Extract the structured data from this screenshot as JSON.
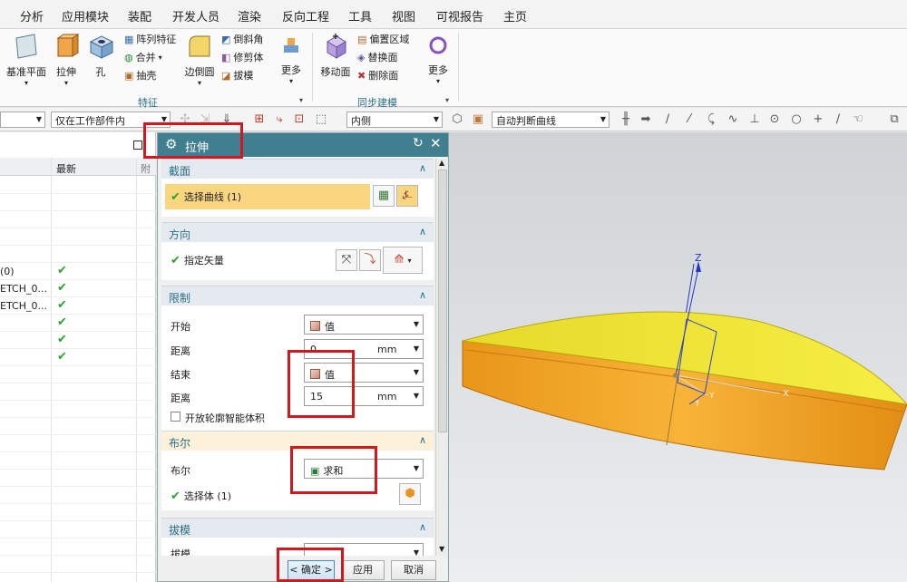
{
  "menu": [
    "分析",
    "应用模块",
    "装配",
    "开发人员",
    "渲染",
    "反向工程",
    "工具",
    "视图",
    "可视报告",
    "主页"
  ],
  "ribbon": {
    "datum_plane": "基准平面",
    "extrude": "拉伸",
    "hole": "孔",
    "pattern_feature": "阵列特征",
    "unite": "合并",
    "shell": "抽壳",
    "edge_blend": "边倒圆",
    "chamfer": "倒斜角",
    "trim_body": "修剪体",
    "draft": "拔模",
    "more1": "更多",
    "group_feature": "特征",
    "move_face": "移动面",
    "offset_region": "偏置区域",
    "replace_face": "替换面",
    "delete_face": "删除面",
    "more2": "更多",
    "group_sync": "同步建模"
  },
  "toolbar": {
    "filter_scope": "仅在工作部件内",
    "side": "内侧",
    "curve_rule": "自动判断曲线"
  },
  "navigator": {
    "col_latest": "最新",
    "rows": [
      {
        "name": "(0)",
        "check": "✔"
      },
      {
        "name": "ETCH_0...",
        "check": "✔"
      },
      {
        "name": "ETCH_0...",
        "check": "✔"
      },
      {
        "name": "",
        "check": "✔"
      },
      {
        "name": "",
        "check": "✔"
      },
      {
        "name": "",
        "check": "✔"
      }
    ]
  },
  "dialog": {
    "title": "拉伸",
    "section": {
      "title": "截面",
      "select_curve": "选择曲线 (1)"
    },
    "direction": {
      "title": "方向",
      "specify_vector": "指定矢量"
    },
    "limits": {
      "title": "限制",
      "start_label": "开始",
      "start_value": "值",
      "distance1_label": "距离",
      "distance1_value": "0",
      "distance1_unit": "mm",
      "end_label": "结束",
      "end_value": "值",
      "distance2_label": "距离",
      "distance2_value": "15",
      "distance2_unit": "mm",
      "open_profile": "开放轮廓智能体积"
    },
    "boolean": {
      "title": "布尔",
      "label": "布尔",
      "value": "求和",
      "select_body": "选择体 (1)"
    },
    "draft": {
      "title": "拔模",
      "label": "拔模"
    },
    "ok": "< 确定 >",
    "apply": "应用",
    "cancel": "取消"
  },
  "viewport": {
    "axis_z": "Z",
    "axis_x": "X",
    "axis_y": "Y"
  },
  "colors": {
    "title_bar": "#3f7f8f",
    "highlight": "#fbd681",
    "body_side": "#f5a623",
    "body_top": "#f2e73a",
    "annotation": "#d0181e"
  }
}
